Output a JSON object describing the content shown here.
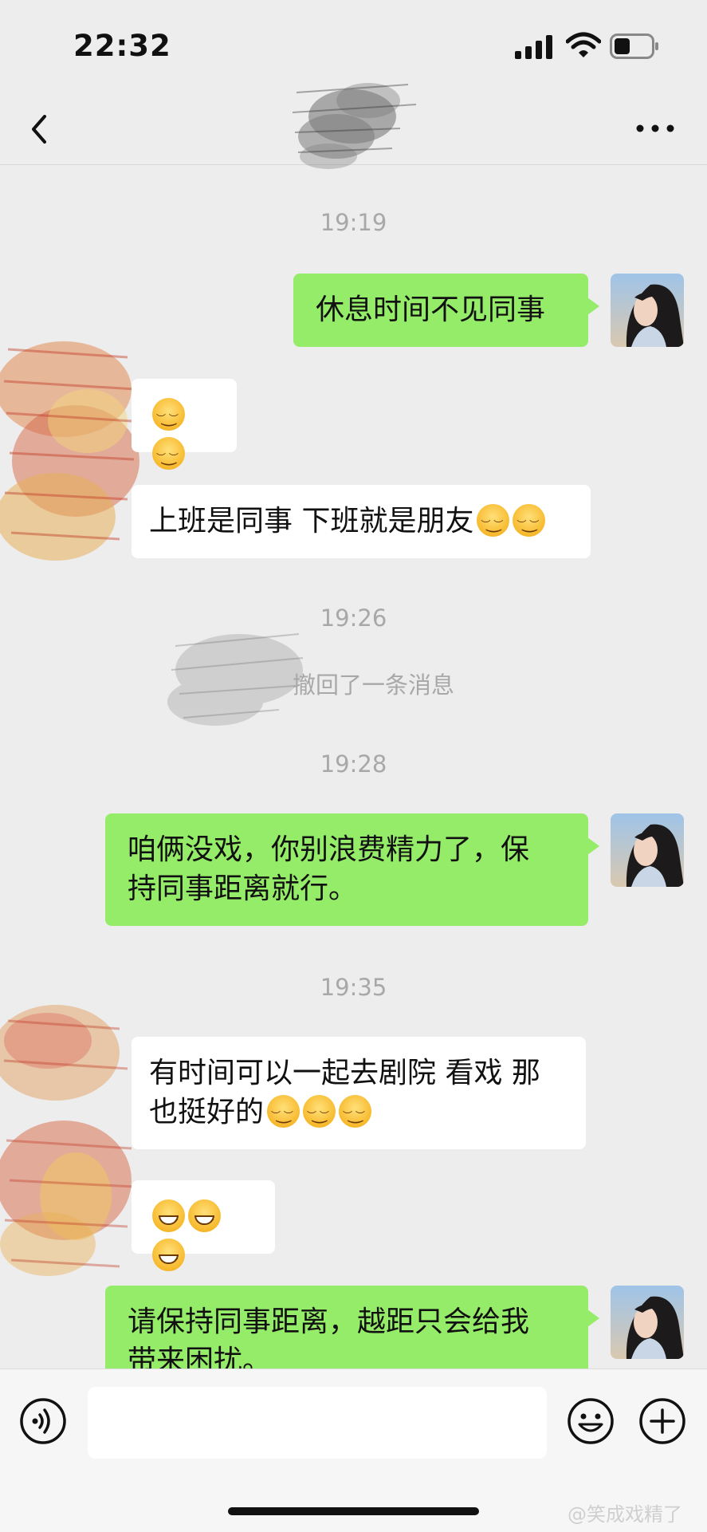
{
  "status_bar": {
    "time": "22:32"
  },
  "nav": {
    "back_icon": "chevron-left-icon",
    "more_icon": "more-dots-icon"
  },
  "messages": {
    "ts1": "19:19",
    "m1": "休息时间不见同事",
    "m3": "上班是同事 下班就是朋友",
    "ts2": "19:26",
    "recall": "撤回了一条消息",
    "ts3": "19:28",
    "m4_line1": "咱俩没戏，你别浪费精力了，保",
    "m4_line2": "持同事距离就行。",
    "ts4": "19:35",
    "m5_line1": "有时间可以一起去剧院 看戏 那",
    "m5_line2": "也挺好的",
    "m7_line1": "请保持同事距离，越距只会给我",
    "m7_line2": "带来困扰。"
  },
  "input_bar": {
    "voice_icon": "voice-icon",
    "emoji_icon": "emoji-icon",
    "plus_icon": "plus-circle-icon"
  },
  "watermark": "@笑成戏精了",
  "colors": {
    "my_bubble": "#95ec69",
    "their_bubble": "#ffffff",
    "background": "#ededed"
  }
}
